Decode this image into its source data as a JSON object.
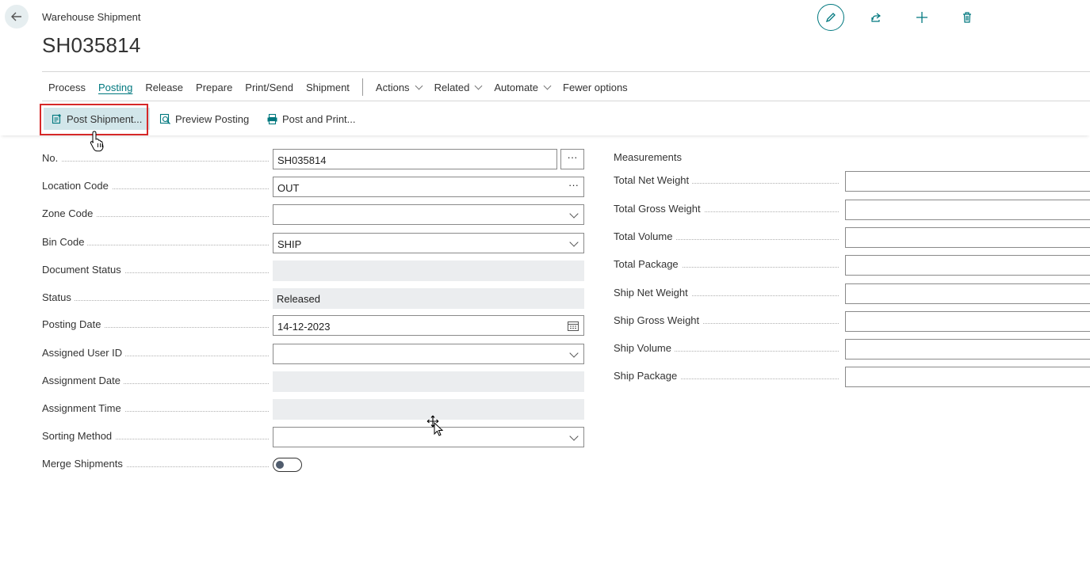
{
  "header": {
    "caption": "Warehouse Shipment",
    "title": "SH035814"
  },
  "top_actions": [
    "edit-icon",
    "share-icon",
    "plus-icon",
    "trash-icon"
  ],
  "menu": {
    "items": [
      {
        "label": "Process"
      },
      {
        "label": "Posting",
        "active": true
      },
      {
        "label": "Release"
      },
      {
        "label": "Prepare"
      },
      {
        "label": "Print/Send"
      },
      {
        "label": "Shipment"
      }
    ],
    "dropdowns": [
      {
        "label": "Actions"
      },
      {
        "label": "Related"
      },
      {
        "label": "Automate"
      }
    ],
    "fewer_options": "Fewer options"
  },
  "actions": {
    "post_shipment": "Post Shipment...",
    "preview_posting": "Preview Posting",
    "post_and_print": "Post and Print..."
  },
  "general": {
    "no": {
      "label": "No.",
      "value": "SH035814"
    },
    "location_code": {
      "label": "Location Code",
      "value": "OUT"
    },
    "zone_code": {
      "label": "Zone Code",
      "value": ""
    },
    "bin_code": {
      "label": "Bin Code",
      "value": "SHIP"
    },
    "document_status": {
      "label": "Document Status",
      "value": ""
    },
    "status": {
      "label": "Status",
      "value": "Released"
    },
    "posting_date": {
      "label": "Posting Date",
      "value": "14-12-2023"
    },
    "assigned_user_id": {
      "label": "Assigned User ID",
      "value": ""
    },
    "assignment_date": {
      "label": "Assignment Date",
      "value": ""
    },
    "assignment_time": {
      "label": "Assignment Time",
      "value": ""
    },
    "sorting_method": {
      "label": "Sorting Method",
      "value": ""
    },
    "merge_shipments": {
      "label": "Merge Shipments",
      "value": false
    }
  },
  "measurements": {
    "title": "Measurements",
    "fields": [
      {
        "label": "Total Net Weight",
        "value": ""
      },
      {
        "label": "Total Gross Weight",
        "value": ""
      },
      {
        "label": "Total Volume",
        "value": ""
      },
      {
        "label": "Total Package",
        "value": ""
      },
      {
        "label": "Ship Net Weight",
        "value": ""
      },
      {
        "label": "Ship Gross Weight",
        "value": ""
      },
      {
        "label": "Ship Volume",
        "value": ""
      },
      {
        "label": "Ship Package",
        "value": ""
      }
    ]
  },
  "colors": {
    "accent": "#00787f",
    "highlight": "#d2e6ea",
    "annotation_box": "#d62828",
    "readonly_bg": "#ebedef"
  }
}
